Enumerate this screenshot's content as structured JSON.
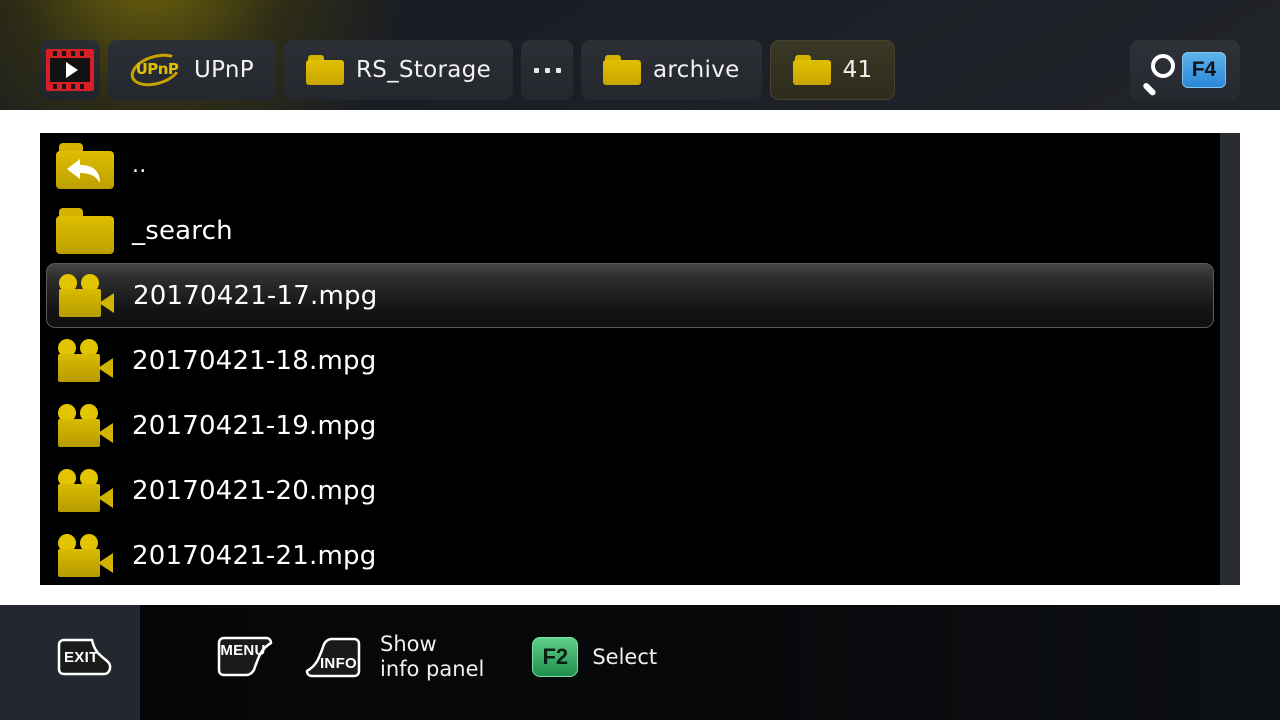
{
  "header": {
    "breadcrumbs": [
      {
        "id": "media-root",
        "icon": "film-play-icon",
        "label": ""
      },
      {
        "id": "upnp",
        "icon": "upnp-logo-icon",
        "label": "UPnP"
      },
      {
        "id": "rs-storage",
        "icon": "folder-icon",
        "label": "RS_Storage"
      },
      {
        "id": "ellipsis",
        "icon": "ellipsis-icon",
        "label": "..."
      },
      {
        "id": "archive",
        "icon": "folder-icon",
        "label": "archive"
      },
      {
        "id": "41",
        "icon": "folder-icon",
        "label": "41"
      }
    ],
    "upnp_logo_text": "UPnP",
    "search": {
      "icon": "search-magnifier-icon",
      "key_label": "F4",
      "key_color": "#2a87d8"
    }
  },
  "list": {
    "rows": [
      {
        "icon": "folder-back-icon",
        "label": ".."
      },
      {
        "icon": "folder-icon",
        "label": "_search"
      },
      {
        "icon": "video-camera-icon",
        "label": "20170421-17.mpg"
      },
      {
        "icon": "video-camera-icon",
        "label": "20170421-18.mpg"
      },
      {
        "icon": "video-camera-icon",
        "label": "20170421-19.mpg"
      },
      {
        "icon": "video-camera-icon",
        "label": "20170421-20.mpg"
      },
      {
        "icon": "video-camera-icon",
        "label": "20170421-21.mpg"
      }
    ],
    "selected_index": 2
  },
  "footer": {
    "actions": [
      {
        "id": "exit",
        "key": "EXIT",
        "caption_line1": "",
        "caption_line2": ""
      },
      {
        "id": "menu",
        "key": "MENU",
        "caption_line1": "",
        "caption_line2": ""
      },
      {
        "id": "info",
        "key": "INFO",
        "caption_line1": "Show",
        "caption_line2": "info panel"
      },
      {
        "id": "select",
        "key": "F2",
        "caption_line1": "Select",
        "caption_line2": ""
      }
    ],
    "select_key_color": "#1f8f4d"
  }
}
